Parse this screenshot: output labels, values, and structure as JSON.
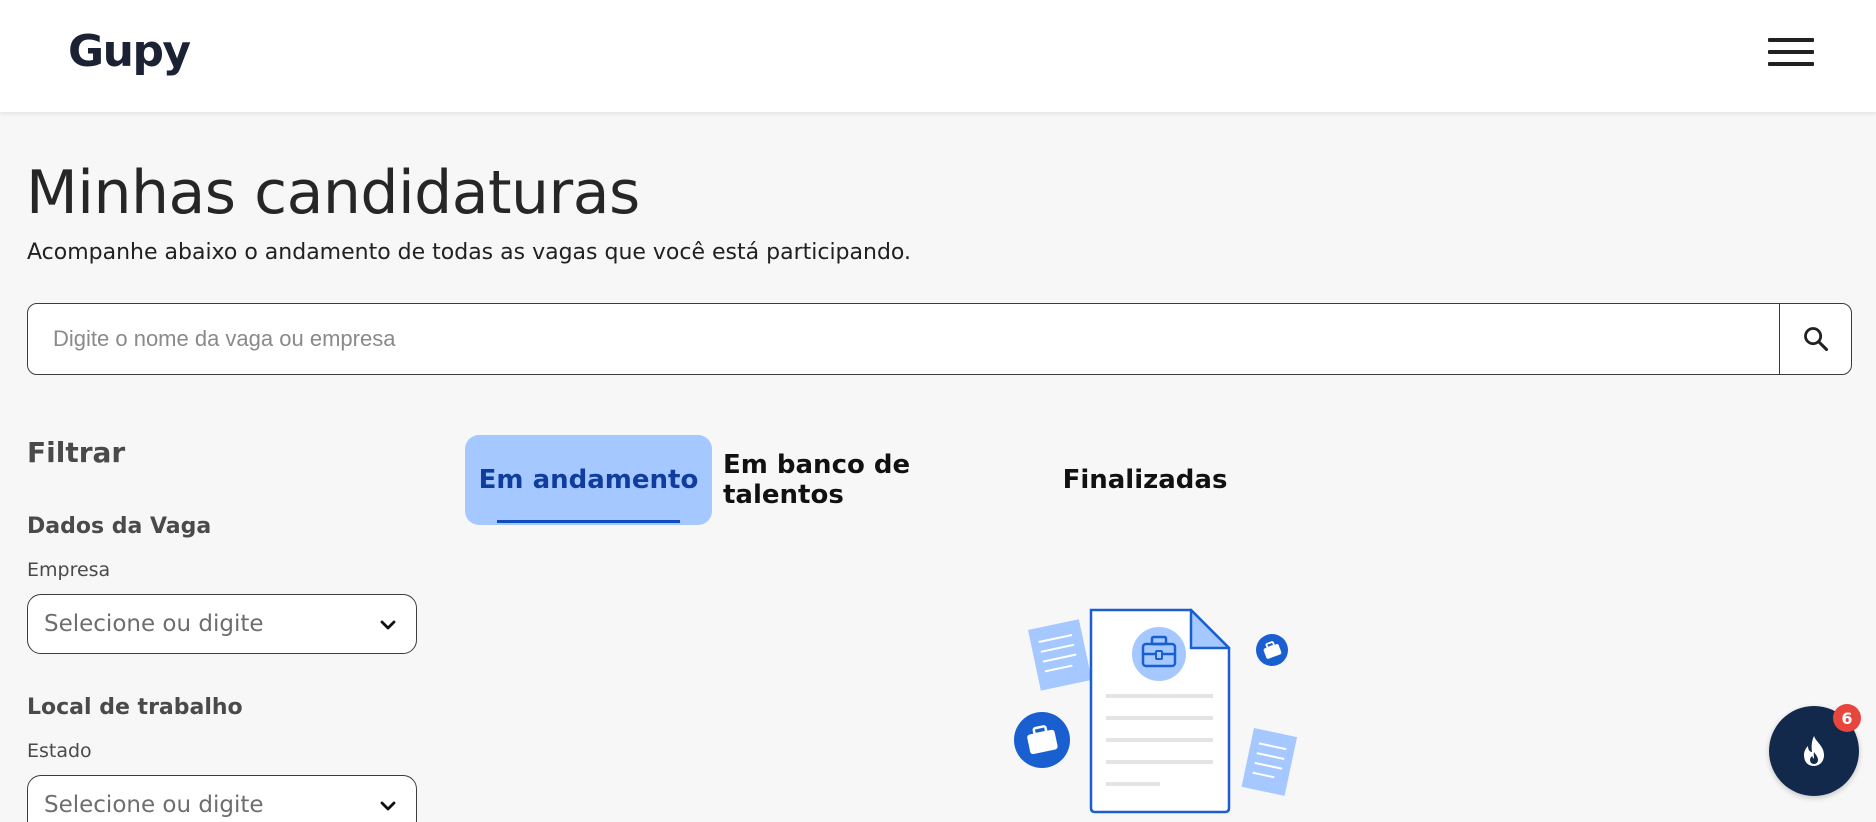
{
  "header": {
    "logo_text": "Gupy",
    "menu_icon": "hamburger-menu-icon"
  },
  "page": {
    "title": "Minhas candidaturas",
    "subtitle": "Acompanhe abaixo o andamento de todas as vagas que você está participando."
  },
  "search": {
    "placeholder": "Digite o nome da vaga ou empresa",
    "value": "",
    "icon": "search-icon"
  },
  "filters": {
    "title": "Filtrar",
    "groups": [
      {
        "title": "Dados da Vaga",
        "label": "Empresa",
        "select_placeholder": "Selecione ou digite"
      },
      {
        "title": "Local de trabalho",
        "label": "Estado",
        "select_placeholder": "Selecione ou digite"
      }
    ]
  },
  "tabs": [
    {
      "label": "Em andamento",
      "active": true
    },
    {
      "label": "Em banco de talentos",
      "active": false
    },
    {
      "label": "Finalizadas",
      "active": false
    }
  ],
  "illustration": {
    "icon": "documents-briefcase-illustration"
  },
  "fab": {
    "icon": "flame-icon",
    "badge_count": "6"
  },
  "colors": {
    "accent_tab_bg": "#a4c8ff",
    "accent_tab_text": "#0f3d9e",
    "fab_bg": "#13294b",
    "badge_bg": "#e8453c"
  }
}
